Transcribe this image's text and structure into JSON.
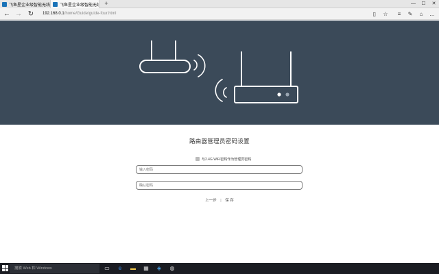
{
  "browser": {
    "tabs": [
      {
        "label": "飞鱼星企业级智能无线 | 商",
        "active": false
      },
      {
        "label": "飞鱼星企业级智能无线",
        "active": true
      }
    ],
    "new_tab": "+",
    "window_controls": [
      "—",
      "☐",
      "✕"
    ],
    "url_host": "192.168.0.1",
    "url_path": "/home/Guide/guide-four.html"
  },
  "page": {
    "title": "路由器管理员密码设置",
    "checkbox_label": "与2.4G WiFi密码作为管理员密码",
    "password_placeholder": "输入密码",
    "confirm_placeholder": "确认密码",
    "prev_label": "上一步",
    "separator": "|",
    "save_label": "保 存"
  },
  "taskbar": {
    "search_placeholder": "搜索 Web 和 Windows"
  },
  "colors": {
    "hero_bg": "#3b4a59",
    "taskbar_bg": "#1a1c22"
  }
}
